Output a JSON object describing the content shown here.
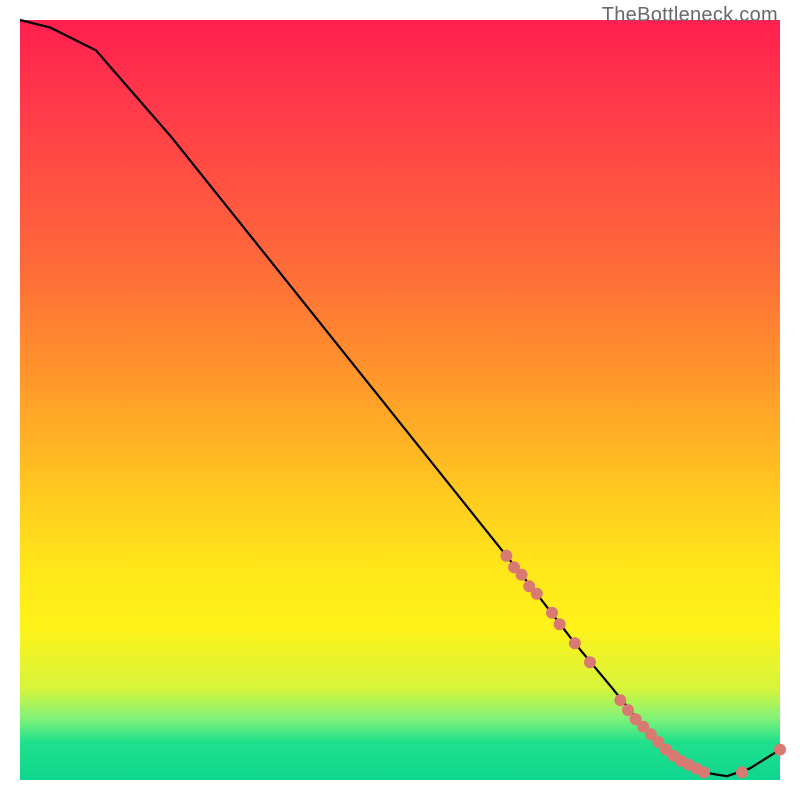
{
  "watermark": "TheBottleneck.com",
  "chart_data": {
    "type": "line",
    "title": "",
    "xlabel": "",
    "ylabel": "",
    "xlim": [
      0,
      100
    ],
    "ylim": [
      0,
      100
    ],
    "grid": false,
    "x": [
      0,
      4,
      10,
      20,
      30,
      40,
      50,
      60,
      64,
      68,
      73,
      78,
      82,
      86,
      90,
      93,
      96,
      100
    ],
    "curve_y": [
      100,
      99,
      96,
      84.5,
      72,
      59.5,
      47,
      34.5,
      29.5,
      24.5,
      18,
      12,
      7,
      3,
      1,
      0.5,
      1.5,
      4
    ],
    "markers": [
      {
        "x": 64,
        "y": 29.5
      },
      {
        "x": 65,
        "y": 28
      },
      {
        "x": 66,
        "y": 27
      },
      {
        "x": 67,
        "y": 25.5
      },
      {
        "x": 68,
        "y": 24.5
      },
      {
        "x": 70,
        "y": 22
      },
      {
        "x": 71,
        "y": 20.5
      },
      {
        "x": 73,
        "y": 18
      },
      {
        "x": 75,
        "y": 15.5
      },
      {
        "x": 79,
        "y": 10.5
      },
      {
        "x": 80,
        "y": 9.2
      },
      {
        "x": 81,
        "y": 8
      },
      {
        "x": 82,
        "y": 7
      },
      {
        "x": 83,
        "y": 6
      },
      {
        "x": 84,
        "y": 5
      },
      {
        "x": 85,
        "y": 4
      },
      {
        "x": 86,
        "y": 3.2
      },
      {
        "x": 87,
        "y": 2.5
      },
      {
        "x": 88,
        "y": 2
      },
      {
        "x": 89,
        "y": 1.5
      },
      {
        "x": 90,
        "y": 1
      },
      {
        "x": 95,
        "y": 1
      },
      {
        "x": 100,
        "y": 4
      }
    ],
    "marker_color": "#d97a72",
    "line_color": "#000000"
  }
}
